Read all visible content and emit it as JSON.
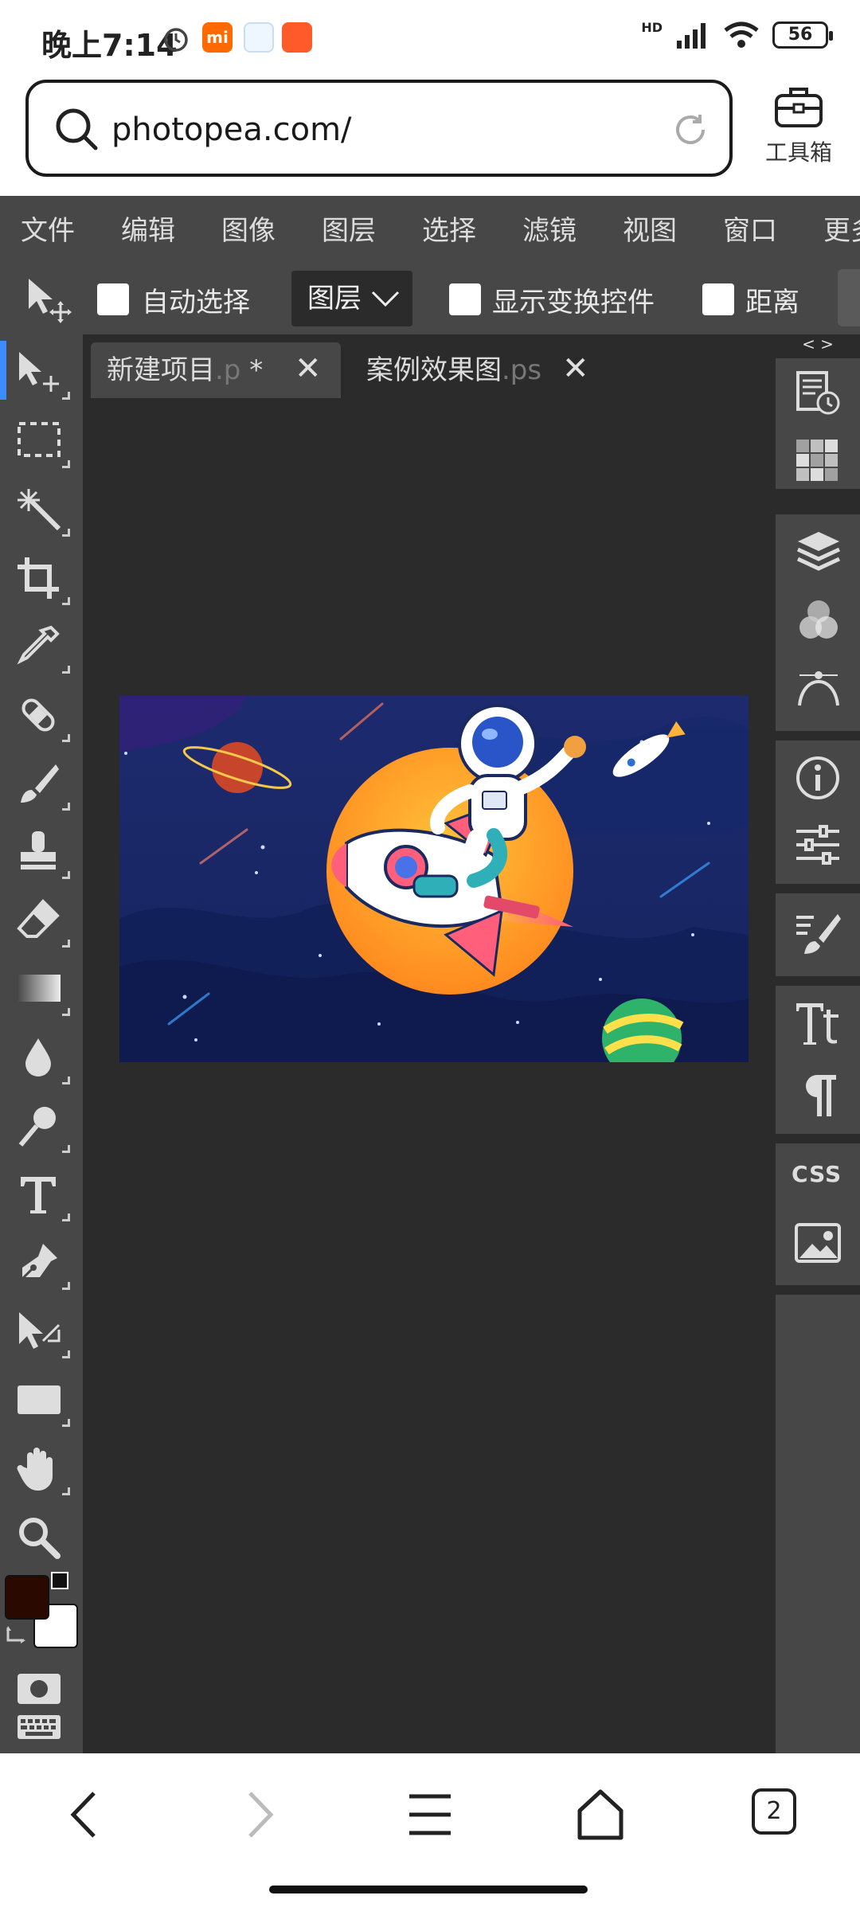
{
  "status_bar": {
    "time": "晚上7:14",
    "network": "HD",
    "battery": "56"
  },
  "browser": {
    "url": "photopea.com/",
    "toolbox_label": "工具箱",
    "tab_count": "2"
  },
  "menu": {
    "items": [
      "文件",
      "编辑",
      "图像",
      "图层",
      "选择",
      "滤镜",
      "视图",
      "窗口",
      "更多"
    ]
  },
  "options_bar": {
    "auto_select": "自动选择",
    "layer_dropdown": "图层",
    "show_transform": "显示变换控件",
    "distance": "距离"
  },
  "document_tabs": [
    {
      "name": "新建项目",
      "ext": ".p",
      "suffix": " *"
    },
    {
      "name": "案例效果图",
      "ext": ".ps",
      "suffix": ""
    }
  ],
  "right_panel": {
    "toggle": "< >",
    "css_label": "CSS"
  },
  "colors": {
    "foreground": "#2a0a00",
    "background": "#ffffff",
    "accent": "#3d8bfd"
  }
}
